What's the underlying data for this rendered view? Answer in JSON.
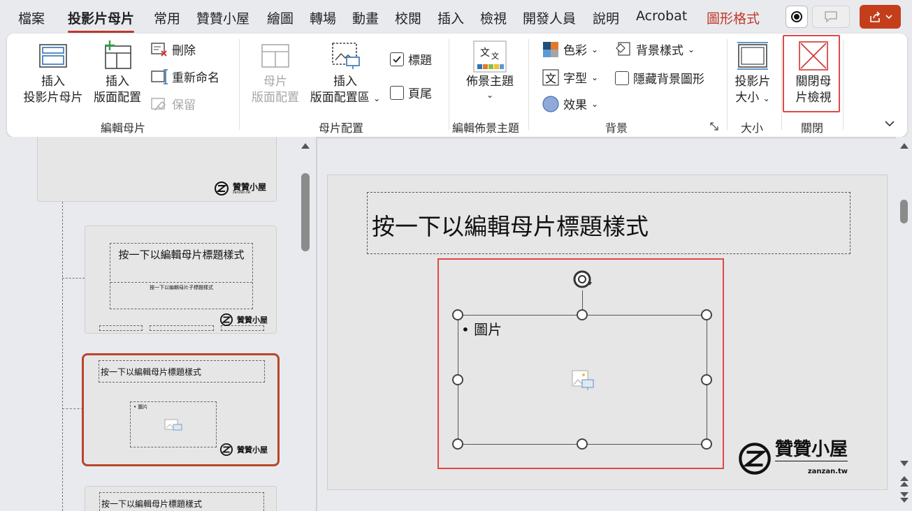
{
  "tabs": {
    "file": "檔案",
    "slide_master": "投影片母片",
    "home": "常用",
    "zanzan": "贊贊小屋",
    "draw": "繪圖",
    "transitions": "轉場",
    "animations": "動畫",
    "review": "校閱",
    "insert": "插入",
    "view": "檢視",
    "developer": "開發人員",
    "help": "說明",
    "acrobat": "Acrobat",
    "shape_format": "圖形格式"
  },
  "ribbon": {
    "insert_slide_master": [
      "插入",
      "投影片母片"
    ],
    "insert_layout": [
      "插入",
      "版面配置"
    ],
    "delete": "刪除",
    "rename": "重新命名",
    "preserve": "保留",
    "master_layout": [
      "母片",
      "版面配置"
    ],
    "insert_placeholder": [
      "插入",
      "版面配置區"
    ],
    "title_checkbox": "標題",
    "footer_checkbox": "頁尾",
    "themes": "佈景主題",
    "colors": "色彩",
    "fonts": "字型",
    "effects": "效果",
    "background_styles": "背景樣式",
    "hide_background": "隱藏背景圖形",
    "slide_size": [
      "投影片",
      "大小"
    ],
    "close_master": [
      "關閉母",
      "片檢視"
    ],
    "groups": {
      "edit_master": "編輯母片",
      "master_layout": "母片配置",
      "edit_theme": "編輯佈景主題",
      "background": "背景",
      "size": "大小",
      "close": "關閉"
    },
    "title_checked": true,
    "footer_checked": false,
    "hide_bg_checked": false
  },
  "thumbnails": {
    "logo_text": "贊贊小屋",
    "logo_sub": "zanzan.tw",
    "thumb2_title": "按一下以編輯母片標題樣式",
    "thumb2_subtitle": "按一下以編輯母片子標題樣式",
    "thumb3_title": "按一下以編輯母片標題樣式",
    "thumb3_bullet": "• 圖片",
    "thumb4_title": "按一下以編輯母片標題樣式"
  },
  "slide": {
    "title": "按一下以編輯母片標題樣式",
    "bullet": "• 圖片",
    "logo_text": "贊贊小屋",
    "logo_sub": "zanzan.tw"
  },
  "colors": {
    "accent": "#c0392b",
    "share": "#c43e1c",
    "highlight": "#e04848",
    "selected_thumb": "#b8462c"
  }
}
